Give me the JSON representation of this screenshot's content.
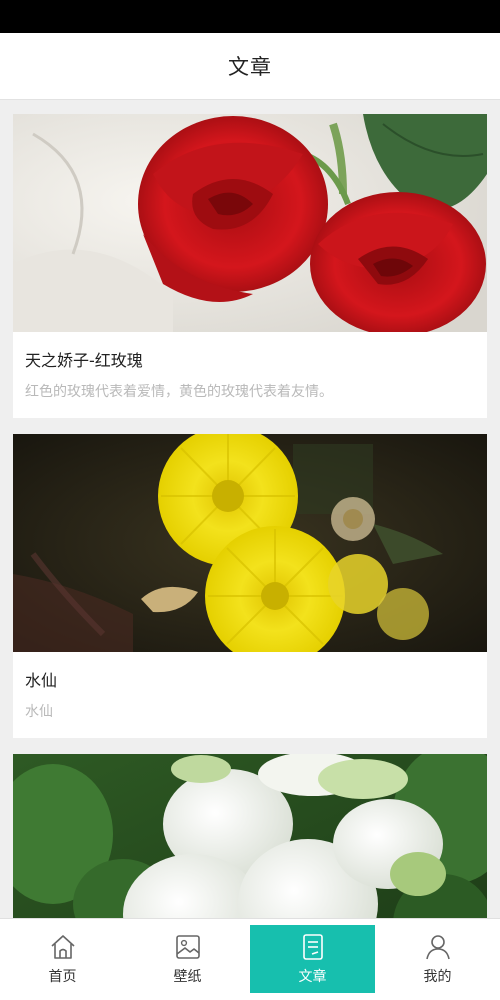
{
  "header": {
    "title": "文章"
  },
  "articles": [
    {
      "title": "天之娇子-红玫瑰",
      "description": "红色的玫瑰代表着爱情，黄色的玫瑰代表着友情。",
      "image": "red-roses"
    },
    {
      "title": "水仙",
      "description": "水仙",
      "image": "yellow-dandelion"
    },
    {
      "title": "",
      "description": "",
      "image": "white-flowers"
    }
  ],
  "tabs": [
    {
      "label": "首页",
      "icon": "home-icon"
    },
    {
      "label": "壁纸",
      "icon": "image-icon"
    },
    {
      "label": "文章",
      "icon": "article-icon",
      "active": true
    },
    {
      "label": "我的",
      "icon": "user-icon"
    }
  ],
  "colors": {
    "accent": "#17bfae",
    "status_bar": "#000000",
    "muted_text": "#b9b9b9"
  }
}
